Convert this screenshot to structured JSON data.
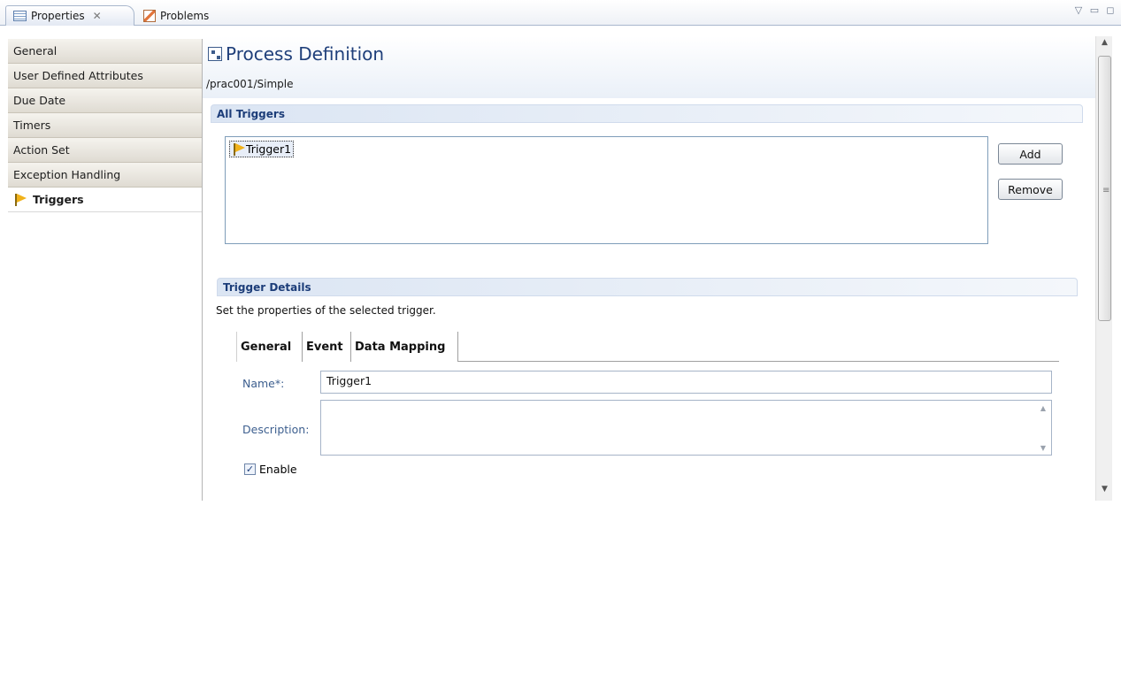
{
  "view_tabs": [
    {
      "label": "Properties",
      "icon": "properties-icon",
      "active": true
    },
    {
      "label": "Problems",
      "icon": "problems-icon",
      "active": false
    }
  ],
  "window_controls": [
    "view-menu-icon",
    "minimize-icon",
    "maximize-icon"
  ],
  "nav": {
    "items": [
      {
        "label": "General"
      },
      {
        "label": "User Defined Attributes"
      },
      {
        "label": "Due Date"
      },
      {
        "label": "Timers"
      },
      {
        "label": "Action Set"
      },
      {
        "label": "Exception Handling"
      },
      {
        "label": "Triggers",
        "selected": true,
        "icon": "flag-icon"
      }
    ]
  },
  "header": {
    "title": "Process Definition",
    "path": "/prac001/Simple"
  },
  "all_triggers": {
    "heading": "All Triggers",
    "items": [
      {
        "label": "Trigger1"
      }
    ],
    "add_label": "Add",
    "remove_label": "Remove"
  },
  "trigger_details": {
    "heading": "Trigger Details",
    "description": "Set the properties of the selected trigger.",
    "tabs": [
      {
        "label": "General",
        "active": true
      },
      {
        "label": "Event"
      },
      {
        "label": "Data Mapping"
      }
    ],
    "name_label": "Name*:",
    "name_value": "Trigger1",
    "description_label": "Description:",
    "description_value": "",
    "enable_label": "Enable",
    "enable_checked": true
  },
  "colors": {
    "section_text": "#1c3d79",
    "field_label": "#3d5f8f",
    "flag": "#f1b21a"
  }
}
